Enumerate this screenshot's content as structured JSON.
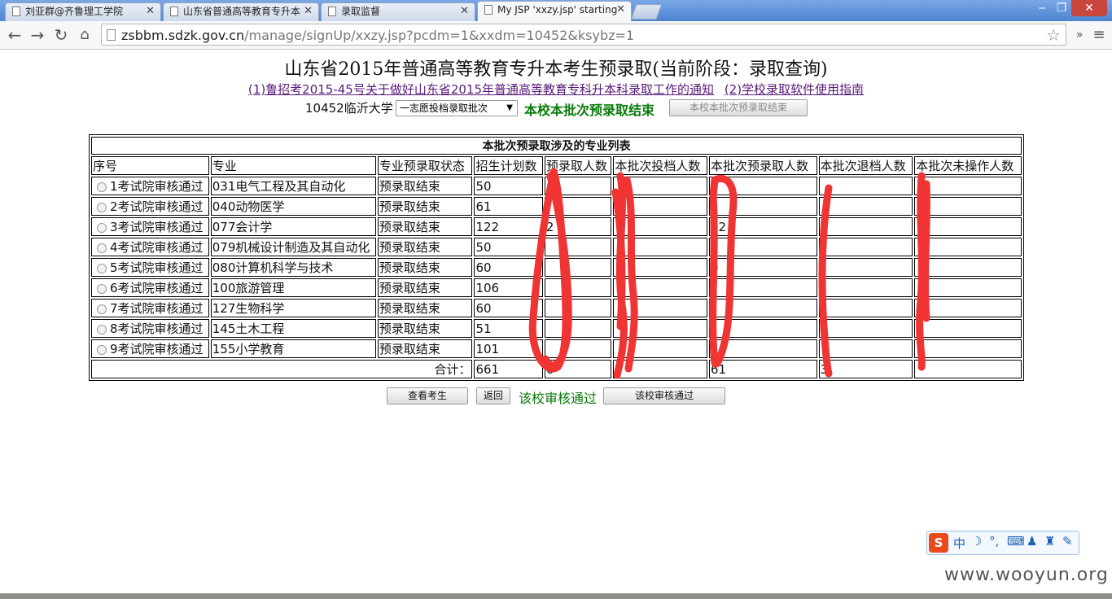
{
  "tabs": [
    {
      "label": "刘亚群@齐鲁理工学院"
    },
    {
      "label": "山东省普通高等教育专升本"
    },
    {
      "label": "录取监督"
    },
    {
      "label": "My JSP 'xxzy.jsp' starting"
    }
  ],
  "window": {
    "minimize": "‒",
    "maximize": "❐",
    "close": "✕"
  },
  "address": {
    "host": "zsbbm.sdzk.gov.cn",
    "path": "/manage/signUp/xxzy.jsp?pcdm=1&xxdm=10452&ksybz=1"
  },
  "page": {
    "title": "山东省2015年普通高等教育专升本考生预录取(当前阶段：录取查询)",
    "link1": "(1)鲁招考2015-45号关于做好山东省2015年普通高等教育专科升本科录取工作的通知",
    "link2": "(2)学校录取软件使用指南",
    "school": "10452临沂大学",
    "batch_select": "一志愿投档录取批次",
    "status_text": "本校本批次预录取结束",
    "end_button": "本校本批次预录取结束"
  },
  "table": {
    "caption": "本批次预录取涉及的专业列表",
    "headers": [
      "序号",
      "专业",
      "专业预录取状态",
      "招生计划数",
      "预录取人数",
      "本批次投档人数",
      "本批次预录取人数",
      "本批次退档人数",
      "本批次未操作人数"
    ],
    "rows": [
      {
        "no": "1考试院审核通过",
        "major": "031电气工程及其自动化",
        "status": "预录取结束",
        "plan": "50",
        "pre": "",
        "cast": "",
        "batch_pre": "0",
        "ret": "",
        "none": ""
      },
      {
        "no": "2考试院审核通过",
        "major": "040动物医学",
        "status": "预录取结束",
        "plan": "61",
        "pre": "",
        "cast": "",
        "batch_pre": "1",
        "ret": "",
        "none": ""
      },
      {
        "no": "3考试院审核通过",
        "major": "077会计学",
        "status": "预录取结束",
        "plan": "122",
        "pre": "2",
        "cast": "",
        "batch_pre": "22",
        "ret": "",
        "none": ""
      },
      {
        "no": "4考试院审核通过",
        "major": "079机械设计制造及其自动化",
        "status": "预录取结束",
        "plan": "50",
        "pre": "",
        "cast": "",
        "batch_pre": "",
        "ret": "",
        "none": ""
      },
      {
        "no": "5考试院审核通过",
        "major": "080计算机科学与技术",
        "status": "预录取结束",
        "plan": "60",
        "pre": "",
        "cast": "",
        "batch_pre": "0",
        "ret": "",
        "none": ""
      },
      {
        "no": "6考试院审核通过",
        "major": "100旅游管理",
        "status": "预录取结束",
        "plan": "106",
        "pre": "",
        "cast": "",
        "batch_pre": "",
        "ret": "",
        "none": ""
      },
      {
        "no": "7考试院审核通过",
        "major": "127生物科学",
        "status": "预录取结束",
        "plan": "60",
        "pre": "",
        "cast": "",
        "batch_pre": "",
        "ret": "",
        "none": ""
      },
      {
        "no": "8考试院审核通过",
        "major": "145土木工程",
        "status": "预录取结束",
        "plan": "51",
        "pre": "",
        "cast": "",
        "batch_pre": "",
        "ret": "",
        "none": ""
      },
      {
        "no": "9考试院审核通过",
        "major": "155小学教育",
        "status": "预录取结束",
        "plan": "101",
        "pre": "",
        "cast": "",
        "batch_pre": "1",
        "ret": "",
        "none": ""
      }
    ],
    "total_label": "合计：",
    "total": {
      "plan": "661",
      "pre": "6",
      "cast": "9",
      "batch_pre": "61",
      "ret": "3",
      "none": ""
    }
  },
  "buttons": {
    "view": "查看考生",
    "back": "返回",
    "pass_text": "该校审核通过",
    "pass_button": "该校审核通过"
  },
  "ime": {
    "lang": "中"
  },
  "watermark": "www.wooyun.org"
}
